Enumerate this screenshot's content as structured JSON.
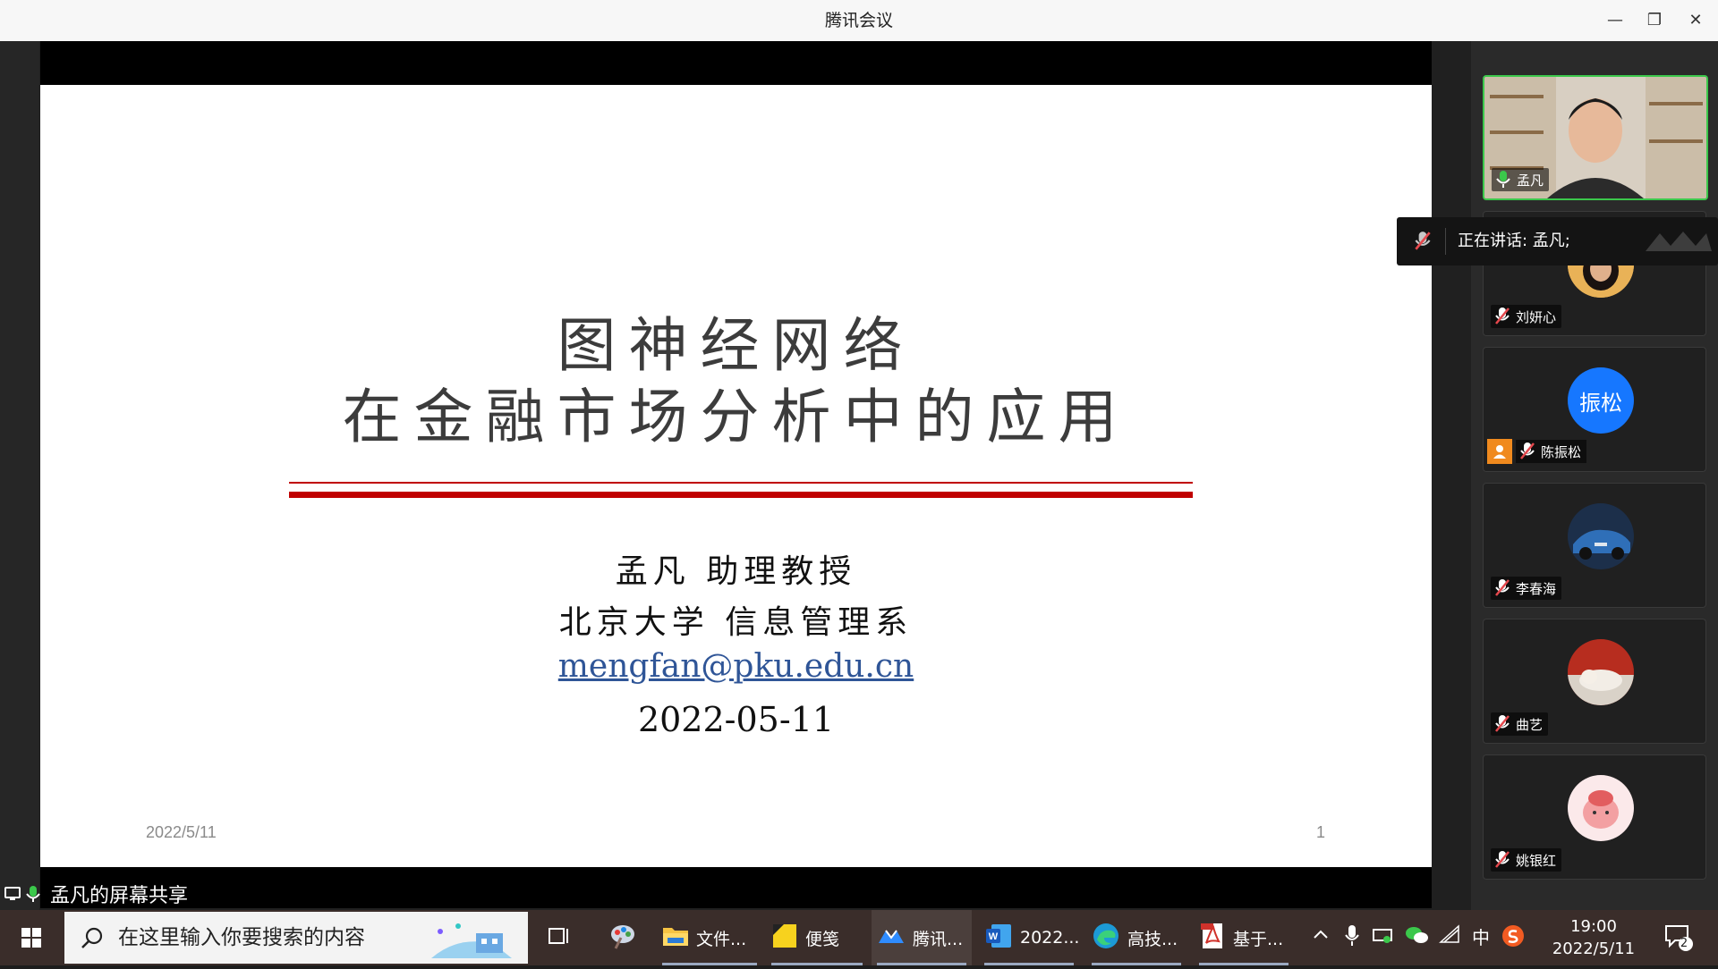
{
  "window": {
    "title": "腾讯会议"
  },
  "slide": {
    "title_line1": "图神经网络",
    "title_line2": "在金融市场分析中的应用",
    "presenter": "孟凡 助理教授",
    "department": "北京大学 信息管理系",
    "email": "mengfan@pku.edu.cn",
    "date": "2022-05-11",
    "footer_date": "2022/5/11",
    "page_number": "1"
  },
  "share": {
    "label": "孟凡的屏幕共享"
  },
  "speaking": {
    "text": "正在讲话: 孟凡;"
  },
  "participants": [
    {
      "name": "孟凡",
      "mic": "on",
      "active": true,
      "avatar": "video"
    },
    {
      "name": "刘妍心",
      "mic": "muted",
      "avatar": "photo"
    },
    {
      "name": "陈振松",
      "mic": "muted",
      "avatar_text": "振松",
      "avatar_color": "#1677ff",
      "host_badge": true
    },
    {
      "name": "李春海",
      "mic": "muted",
      "avatar": "car-photo"
    },
    {
      "name": "曲艺",
      "mic": "muted",
      "avatar": "cat-photo"
    },
    {
      "name": "姚银红",
      "mic": "muted",
      "avatar": "cartoon"
    }
  ],
  "taskbar": {
    "search_placeholder": "在这里输入你要搜索的内容",
    "apps": [
      {
        "label": "文件...",
        "icon": "folder-icon"
      },
      {
        "label": "便笺",
        "icon": "sticky-notes-icon"
      },
      {
        "label": "腾讯...",
        "icon": "tencent-meeting-icon",
        "active": true
      },
      {
        "label": "2022...",
        "icon": "word-icon"
      },
      {
        "label": "高技...",
        "icon": "edge-icon"
      },
      {
        "label": "基于...",
        "icon": "pdf-icon"
      }
    ],
    "ime": "中",
    "time": "19:00",
    "date": "2022/5/11",
    "notification_count": "2"
  },
  "colors": {
    "accent_red": "#c00000",
    "link_blue": "#2f5597",
    "active_border": "#3bc84b",
    "mic_green": "#3bc84b"
  }
}
